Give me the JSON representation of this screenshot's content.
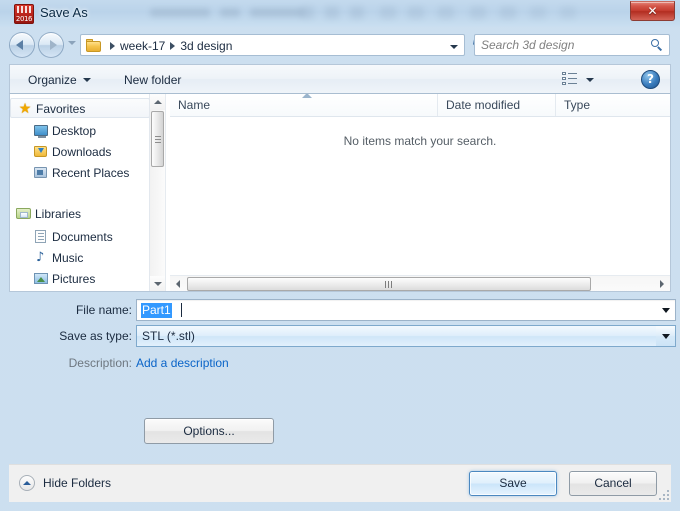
{
  "window": {
    "title": "Save As",
    "app_icon": "solidworks-icon",
    "app_icon_year": "2016",
    "close_label": "✕"
  },
  "nav": {
    "back_icon": "back-arrow-icon",
    "forward_icon": "forward-arrow-icon",
    "recent_icon": "recent-pages-chevron-icon",
    "folder_icon": "folder-icon",
    "breadcrumb": [
      "week-17",
      "3d design"
    ],
    "address_dropdown_icon": "chevron-down-icon",
    "refresh_icon": "refresh-icon",
    "refresh_glyph": "↯"
  },
  "search": {
    "placeholder": "Search 3d design",
    "icon": "search-icon"
  },
  "toolbar": {
    "organize_label": "Organize",
    "new_folder_label": "New folder",
    "view_mode_icon": "list-view-icon",
    "view_mode_caret_icon": "chevron-down-icon",
    "help_label": "?",
    "help_icon": "help-icon"
  },
  "sidebar": {
    "groups": [
      {
        "label": "Favorites",
        "icon": "star-icon",
        "selected": true,
        "items": [
          {
            "label": "Desktop",
            "icon": "desktop-icon"
          },
          {
            "label": "Downloads",
            "icon": "downloads-icon"
          },
          {
            "label": "Recent Places",
            "icon": "recent-places-icon"
          }
        ]
      },
      {
        "label": "Libraries",
        "icon": "libraries-icon",
        "selected": false,
        "items": [
          {
            "label": "Documents",
            "icon": "documents-icon"
          },
          {
            "label": "Music",
            "icon": "music-icon"
          },
          {
            "label": "Pictures",
            "icon": "pictures-icon"
          }
        ]
      }
    ]
  },
  "filelist": {
    "columns": [
      "Name",
      "Date modified",
      "Type"
    ],
    "rows": [],
    "empty_message": "No items match your search.",
    "sort_indicator_icon": "sort-ascending-icon"
  },
  "form": {
    "filename_label": "File name:",
    "filename_value": "Part1",
    "filename_selected": true,
    "savetype_label": "Save as type:",
    "savetype_value": "STL (*.stl)",
    "description_label": "Description:",
    "description_link": "Add a description",
    "dropdown_icon": "chevron-down-icon"
  },
  "buttons": {
    "options_label": "Options...",
    "save_label": "Save",
    "cancel_label": "Cancel",
    "hide_folders_label": "Hide Folders",
    "hide_folders_icon": "chevron-up-circle-icon"
  },
  "colors": {
    "accent_blue": "#3399ff",
    "link_blue": "#0a64c8",
    "close_red": "#c23a2d",
    "glass_blue": "#c4daee",
    "folder_yellow": "#f5c34b"
  }
}
